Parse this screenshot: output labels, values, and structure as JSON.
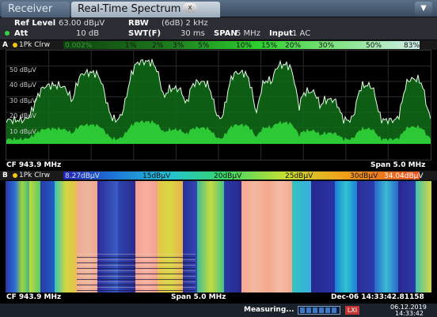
{
  "tabs": {
    "receiver": "Receiver",
    "realtime": "Real-Time Spectrum",
    "close": "x",
    "menu": "▼"
  },
  "settings": {
    "ref_level_label": "Ref Level",
    "ref_level_value": "63.00 dBμV",
    "att_label": "Att",
    "att_value": "10 dB",
    "rbw_label": "RBW",
    "rbw_value": "(6dB) 2 kHz",
    "swt_label": "SWT(F)",
    "swt_value": "30 ms",
    "span_label": "SPAN",
    "span_value": "5 MHz",
    "input_label": "Input",
    "input_value": "1 AC"
  },
  "window_a": {
    "letter": "A",
    "trace": "1Pk Clrw",
    "pct_labels": [
      "0.002%",
      "1%",
      "2%",
      "3%",
      "5%",
      "10%",
      "15%",
      "20%",
      "30%",
      "50%",
      "83%"
    ],
    "y_labels": [
      "50 dBμV",
      "40 dBμV",
      "30 dBμV",
      "20 dBμV",
      "10 dBμV"
    ],
    "cf": "CF 943.9 MHz",
    "span": "Span 5.0 MHz"
  },
  "window_b": {
    "letter": "B",
    "trace": "1Pk Clrw",
    "scale_labels": [
      "8.27dBμV",
      "15dBμV",
      "20dBμV",
      "25dBμV",
      "30dBμV",
      "34.04dBμV"
    ],
    "cf": "CF 943.9 MHz",
    "span": "Span 5.0 MHz",
    "timestamp": "Dec-06 14:33:42.81158"
  },
  "status": {
    "text": "Measuring...",
    "icon": "LXI",
    "date": "06.12.2019",
    "time": "14:33:42"
  },
  "colors": {
    "trace": "#36e03a",
    "spectrogram_low": "#222a80",
    "spectrogram_high": "#f0a090"
  }
}
